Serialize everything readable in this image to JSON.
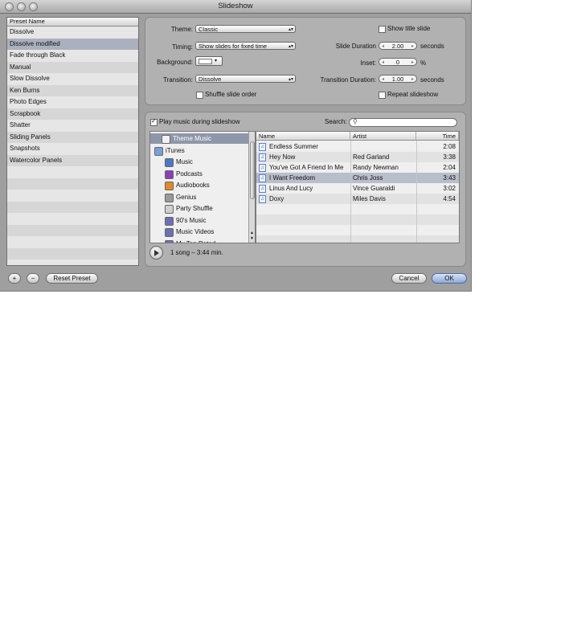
{
  "window": {
    "title": "Slideshow"
  },
  "presets": {
    "header": "Preset Name",
    "items": [
      "Dissolve",
      "Dissolve modified",
      "Fade through Black",
      "Manual",
      "Slow Dissolve",
      "Ken Burns",
      "Photo Edges",
      "Scrapbook",
      "Shatter",
      "Sliding Panels",
      "Snapshots",
      "Watercolor Panels"
    ],
    "selected_index": 1,
    "add_label": "+",
    "remove_label": "−",
    "reset_label": "Reset Preset"
  },
  "settings": {
    "theme_label": "Theme:",
    "theme_value": "Classic",
    "timing_label": "Timing:",
    "timing_value": "Show slides for fixed time",
    "background_label": "Background:",
    "transition_label": "Transition:",
    "transition_value": "Dissolve",
    "shuffle_label": "Shuffle slide order",
    "show_title_label": "Show title slide",
    "slide_duration_label": "Slide Duration",
    "slide_duration_value": "2.00",
    "slide_duration_unit": "seconds",
    "inset_label": "Inset:",
    "inset_value": "0",
    "inset_unit": "%",
    "transition_duration_label": "Transition Duration:",
    "transition_duration_value": "1.00",
    "transition_duration_unit": "seconds",
    "repeat_label": "Repeat slideshow"
  },
  "music": {
    "play_label": "Play music during slideshow",
    "search_label": "Search:",
    "sources": [
      {
        "label": "Theme Music",
        "icon": "theme-music-icon"
      },
      {
        "label": "iTunes",
        "icon": "itunes-icon"
      },
      {
        "label": "Music",
        "icon": "music-note-icon"
      },
      {
        "label": "Podcasts",
        "icon": "podcast-icon"
      },
      {
        "label": "Audiobooks",
        "icon": "audiobook-icon"
      },
      {
        "label": "Genius",
        "icon": "genius-icon"
      },
      {
        "label": "Party Shuffle",
        "icon": "party-shuffle-icon"
      },
      {
        "label": "90's Music",
        "icon": "smart-playlist-icon"
      },
      {
        "label": "Music Videos",
        "icon": "smart-playlist-icon"
      },
      {
        "label": "My Top Rated",
        "icon": "smart-playlist-icon"
      }
    ],
    "columns": {
      "name": "Name",
      "artist": "Artist",
      "time": "Time"
    },
    "songs": [
      {
        "name": "Endless Summer",
        "artist": "",
        "time": "2:08"
      },
      {
        "name": "Hey Now",
        "artist": "Red Garland",
        "time": "3:38"
      },
      {
        "name": "You've Got A Friend In Me",
        "artist": "Randy Newman",
        "time": "2:04"
      },
      {
        "name": "I Want Freedom",
        "artist": "Chris Joss",
        "time": "3:43"
      },
      {
        "name": "Linus And Lucy",
        "artist": "Vince Guaraldi",
        "time": "3:02"
      },
      {
        "name": "Doxy",
        "artist": "Miles Davis",
        "time": "4:54"
      }
    ],
    "selected_song_index": 3,
    "summary": "1 song – 3:44 min."
  },
  "actions": {
    "cancel_label": "Cancel",
    "ok_label": "OK"
  }
}
